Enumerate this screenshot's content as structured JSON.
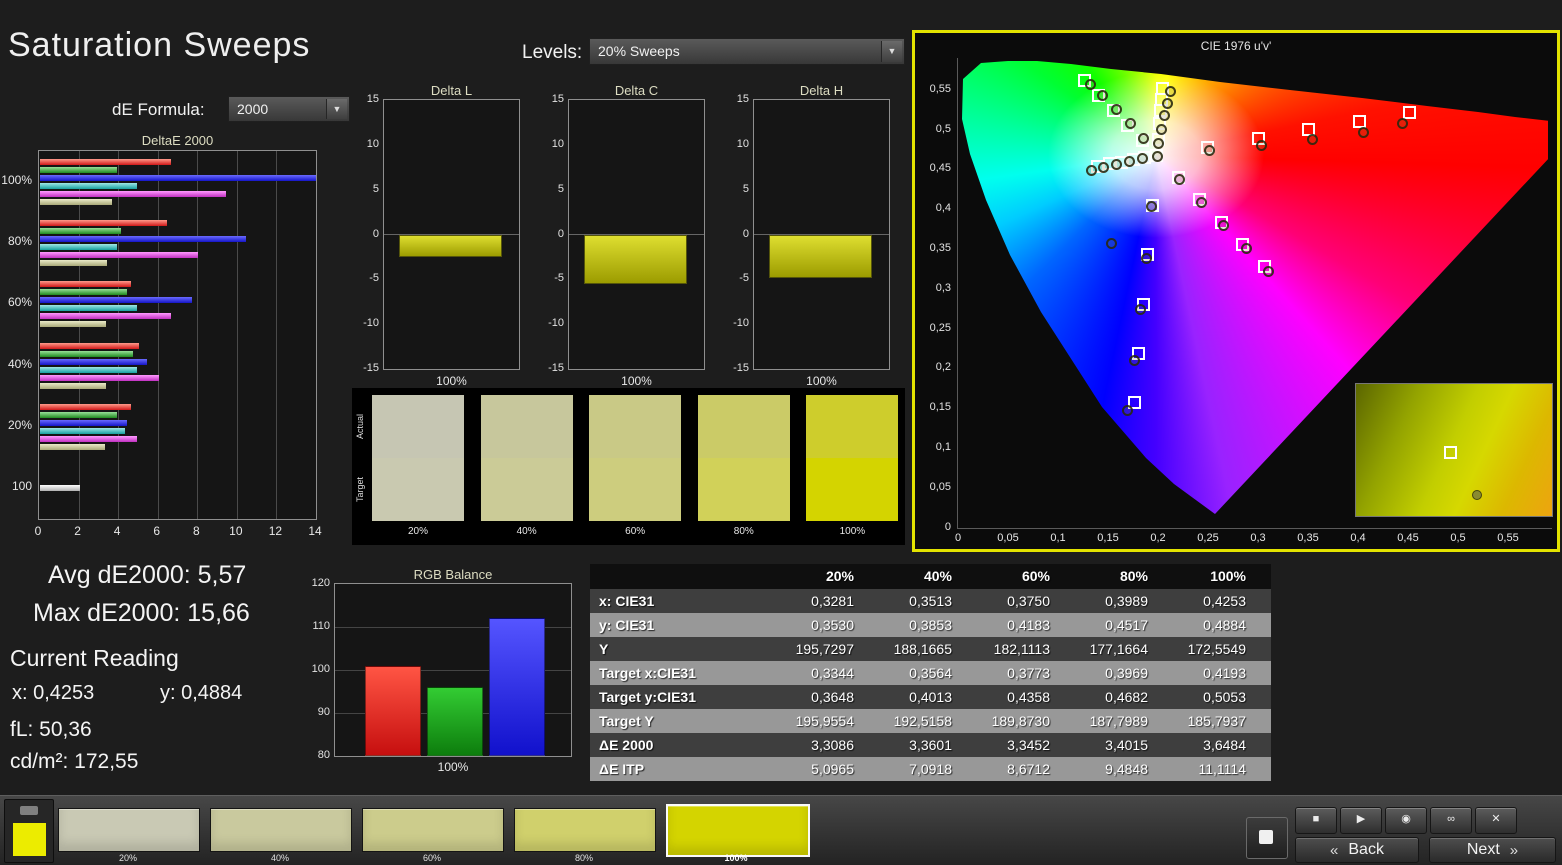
{
  "app": {
    "title": "Saturation Sweeps"
  },
  "header": {
    "de_formula_label": "dE Formula:",
    "de_formula_value": "2000",
    "levels_label": "Levels:",
    "levels_value": "20% Sweeps"
  },
  "icons": {
    "chevron_down": "▼"
  },
  "stats": {
    "avg": "Avg dE2000: 5,57",
    "max": "Max dE2000: 15,66",
    "current_reading": "Current Reading",
    "x": "x: 0,4253",
    "y": "y: 0,4884",
    "fl": "fL: 50,36",
    "luminance": "cd/m²: 172,55"
  },
  "chart_data": [
    {
      "type": "bar",
      "orientation": "horizontal",
      "title": "DeltaE 2000",
      "categories": [
        "100%",
        "80%",
        "60%",
        "40%",
        "20%",
        "100"
      ],
      "xticks": [
        0,
        2,
        4,
        6,
        8,
        10,
        12,
        14
      ],
      "xlim": [
        0,
        14
      ],
      "series": [
        {
          "name": "red",
          "c1": "#ff9a8a",
          "c2": "#d01818",
          "values": [
            6.6,
            6.4,
            4.6,
            5.0,
            4.6,
            null
          ]
        },
        {
          "name": "green",
          "c1": "#98e098",
          "c2": "#1f8a1f",
          "values": [
            3.9,
            4.1,
            4.4,
            4.7,
            3.9,
            null
          ]
        },
        {
          "name": "blue",
          "c1": "#6a6aff",
          "c2": "#1515c8",
          "values": [
            15.66,
            10.4,
            7.7,
            5.4,
            4.4,
            null
          ]
        },
        {
          "name": "cyan",
          "c1": "#9fe8e8",
          "c2": "#17a0a0",
          "values": [
            4.9,
            3.9,
            4.9,
            4.9,
            4.3,
            null
          ]
        },
        {
          "name": "magenta",
          "c1": "#ff9aff",
          "c2": "#c030c0",
          "values": [
            9.4,
            8.0,
            6.6,
            6.0,
            4.9,
            null
          ]
        },
        {
          "name": "yellow",
          "c1": "#eaeac8",
          "c2": "#a8a878",
          "values": [
            3.65,
            3.4,
            3.35,
            3.36,
            3.31,
            null
          ]
        },
        {
          "name": "white",
          "c1": "#ffffff",
          "c2": "#b0b0b0",
          "values": [
            null,
            null,
            null,
            null,
            null,
            2.0
          ]
        }
      ]
    },
    {
      "type": "bar",
      "title": "Delta L",
      "categories": [
        "100%"
      ],
      "values": [
        -2.4
      ],
      "yticks": [
        15,
        10,
        5,
        0,
        -5,
        -10,
        -15
      ],
      "ylim": [
        -15,
        15
      ],
      "xlabel": "100%"
    },
    {
      "type": "bar",
      "title": "Delta C",
      "categories": [
        "100%"
      ],
      "values": [
        -5.5
      ],
      "yticks": [
        15,
        10,
        5,
        0,
        -5,
        -10,
        -15
      ],
      "ylim": [
        -15,
        15
      ],
      "xlabel": "100%"
    },
    {
      "type": "bar",
      "title": "Delta H",
      "categories": [
        "100%"
      ],
      "values": [
        -4.8
      ],
      "yticks": [
        15,
        10,
        5,
        0,
        -5,
        -10,
        -15
      ],
      "ylim": [
        -15,
        15
      ],
      "xlabel": "100%"
    },
    {
      "type": "bar",
      "title": "RGB Balance",
      "categories": [
        "Red",
        "Green",
        "Blue"
      ],
      "values": [
        101,
        96,
        112
      ],
      "colors": [
        [
          "#ff5544",
          "#c60f0f"
        ],
        [
          "#33cc33",
          "#0d7d0d"
        ],
        [
          "#5555ff",
          "#1111cc"
        ]
      ],
      "yticks": [
        120,
        110,
        100,
        90,
        80
      ],
      "ylim": [
        80,
        120
      ],
      "xlabel": "100%"
    },
    {
      "type": "scatter",
      "title": "CIE 1976 u'v'",
      "xlim": [
        0,
        0.6
      ],
      "ylim": [
        0,
        0.59
      ],
      "xtick_values": [
        0,
        0.05,
        0.1,
        0.15,
        0.2,
        0.25,
        0.3,
        0.35,
        0.4,
        0.45,
        0.5,
        0.55
      ],
      "xtick_labels": [
        "0",
        "0,05",
        "0,1",
        "0,15",
        "0,2",
        "0,25",
        "0,3",
        "0,35",
        "0,4",
        "0,45",
        "0,5",
        "0,55"
      ],
      "ytick_values": [
        0,
        0.05,
        0.1,
        0.15,
        0.2,
        0.25,
        0.3,
        0.35,
        0.4,
        0.45,
        0.5,
        0.55
      ],
      "ytick_labels": [
        "0",
        "0,05",
        "0,1",
        "0,15",
        "0,2",
        "0,25",
        "0,3",
        "0,35",
        "0,4",
        "0,45",
        "0,5",
        "0,55"
      ],
      "targets": [
        [
          0.1978,
          0.4683
        ],
        [
          0.2484,
          0.4792
        ],
        [
          0.299,
          0.4901
        ],
        [
          0.3495,
          0.5011
        ],
        [
          0.4001,
          0.512
        ],
        [
          0.4507,
          0.5229
        ],
        [
          0.1832,
          0.4871
        ],
        [
          0.1687,
          0.506
        ],
        [
          0.1541,
          0.5248
        ],
        [
          0.1396,
          0.5437
        ],
        [
          0.125,
          0.5625
        ],
        [
          0.1933,
          0.4062
        ],
        [
          0.1888,
          0.3441
        ],
        [
          0.1844,
          0.2821
        ],
        [
          0.1799,
          0.22
        ],
        [
          0.1754,
          0.1579
        ],
        [
          0.1859,
          0.4657
        ],
        [
          0.174,
          0.4632
        ],
        [
          0.1621,
          0.4606
        ],
        [
          0.1502,
          0.4581
        ],
        [
          0.1383,
          0.4555
        ],
        [
          0.2192,
          0.4406
        ],
        [
          0.2407,
          0.4129
        ],
        [
          0.2621,
          0.3851
        ],
        [
          0.2836,
          0.3574
        ],
        [
          0.305,
          0.3297
        ],
        [
          0.1994,
          0.4894
        ],
        [
          0.2007,
          0.5085
        ],
        [
          0.2019,
          0.5247
        ],
        [
          0.2029,
          0.5385
        ],
        [
          0.2039,
          0.5529
        ]
      ],
      "measurements": [
        [
          0.1992,
          0.4668
        ],
        [
          0.1995,
          0.4829
        ],
        [
          0.203,
          0.501
        ],
        [
          0.2063,
          0.5179
        ],
        [
          0.2093,
          0.5333
        ],
        [
          0.2124,
          0.5488
        ],
        [
          0.2513,
          0.4738
        ],
        [
          0.3028,
          0.4809
        ],
        [
          0.3542,
          0.4887
        ],
        [
          0.4048,
          0.4966
        ],
        [
          0.4442,
          0.5078
        ],
        [
          0.1847,
          0.4896
        ],
        [
          0.1716,
          0.5079
        ],
        [
          0.1581,
          0.5262
        ],
        [
          0.1443,
          0.5436
        ],
        [
          0.1317,
          0.557
        ],
        [
          0.1929,
          0.4043
        ],
        [
          0.1878,
          0.3392
        ],
        [
          0.1821,
          0.2748
        ],
        [
          0.1759,
          0.2108
        ],
        [
          0.1687,
          0.1482
        ],
        [
          0.1836,
          0.4641
        ],
        [
          0.1708,
          0.4605
        ],
        [
          0.1577,
          0.4567
        ],
        [
          0.1452,
          0.4532
        ],
        [
          0.1333,
          0.4499
        ],
        [
          0.2205,
          0.4377
        ],
        [
          0.2428,
          0.4087
        ],
        [
          0.2653,
          0.3797
        ],
        [
          0.2878,
          0.3508
        ],
        [
          0.3102,
          0.3219
        ],
        [
          0.153,
          0.357
        ]
      ]
    }
  ],
  "sample_strip": {
    "actual_label": "Actual",
    "target_label": "Target",
    "columns": [
      {
        "label": "20%",
        "actual": "#c6c6b3",
        "target": "#c9c9b0"
      },
      {
        "label": "40%",
        "actual": "#c7c79c",
        "target": "#cbcb97"
      },
      {
        "label": "60%",
        "actual": "#c9c986",
        "target": "#cdcd7e"
      },
      {
        "label": "80%",
        "actual": "#cbcb67",
        "target": "#d1d159"
      },
      {
        "label": "100%",
        "actual": "#cecd2c",
        "target": "#d4d400"
      }
    ]
  },
  "table": {
    "header": [
      "",
      "20%",
      "40%",
      "60%",
      "80%",
      "100%"
    ],
    "rows": [
      {
        "label": "x: CIE31",
        "values": [
          "0,3281",
          "0,3513",
          "0,3750",
          "0,3989",
          "0,4253"
        ]
      },
      {
        "label": "y: CIE31",
        "values": [
          "0,3530",
          "0,3853",
          "0,4183",
          "0,4517",
          "0,4884"
        ]
      },
      {
        "label": "Y",
        "values": [
          "195,7297",
          "188,1665",
          "182,1113",
          "177,1664",
          "172,5549"
        ]
      },
      {
        "label": "Target x:CIE31",
        "values": [
          "0,3344",
          "0,3564",
          "0,3773",
          "0,3969",
          "0,4193"
        ]
      },
      {
        "label": "Target y:CIE31",
        "values": [
          "0,3648",
          "0,4013",
          "0,4358",
          "0,4682",
          "0,5053"
        ]
      },
      {
        "label": "Target Y",
        "values": [
          "195,9554",
          "192,5158",
          "189,8730",
          "187,7989",
          "185,7937"
        ]
      },
      {
        "label": "ΔE 2000",
        "values": [
          "3,3086",
          "3,3601",
          "3,3452",
          "3,4015",
          "3,6484"
        ]
      },
      {
        "label": "ΔE ITP",
        "values": [
          "5,0965",
          "7,0918",
          "8,6712",
          "9,4848",
          "11,1114"
        ]
      }
    ]
  },
  "bottom_bar": {
    "preview_color": "#ecec00",
    "tiles": [
      {
        "label": "20%",
        "color": "#c9c9b4",
        "active": false
      },
      {
        "label": "40%",
        "color": "#c9c99e",
        "active": false
      },
      {
        "label": "60%",
        "color": "#cccc8c",
        "active": false
      },
      {
        "label": "80%",
        "color": "#d0d06c",
        "active": false
      },
      {
        "label": "100%",
        "color": "#d4d400",
        "active": true
      }
    ],
    "transport": [
      {
        "name": "stop",
        "glyph": "■"
      },
      {
        "name": "play",
        "glyph": "▶"
      },
      {
        "name": "read-once",
        "glyph": "◉"
      },
      {
        "name": "read-continuous",
        "glyph": "∞"
      },
      {
        "name": "close",
        "glyph": "✕"
      }
    ],
    "back_glyph": "«",
    "back_label": "Back",
    "next_label": "Next",
    "next_glyph": "»"
  }
}
